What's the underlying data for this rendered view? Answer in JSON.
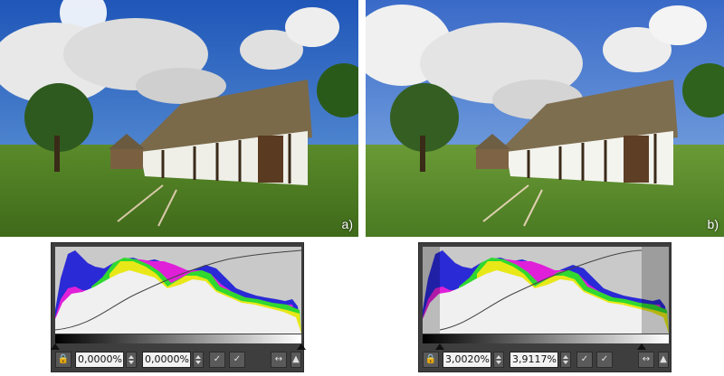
{
  "panels": [
    {
      "label": "a)",
      "low_value": "0,0000%",
      "high_value": "0,0000%",
      "clip_low": 0.0,
      "clip_high": 0.0,
      "black_marker": 0.0,
      "white_marker": 1.0
    },
    {
      "label": "b)",
      "low_value": "3,0020%",
      "high_value": "3,9117%",
      "clip_low": 0.07,
      "clip_high": 0.89,
      "black_marker": 0.07,
      "white_marker": 0.89
    }
  ],
  "icons": {
    "lock": "lock-icon",
    "black_picker": "eyedropper-black-icon",
    "white_picker": "eyedropper-white-icon",
    "fit": "fit-width-icon",
    "expand": "expand-icon"
  },
  "colors": {
    "panel_bg": "#3e3e3e",
    "hist_bg": "#c9c9c9",
    "blue": "#2a2ad6",
    "magenta": "#e020d8",
    "yellow": "#e8e818",
    "green": "#30d830",
    "red": "#e02020",
    "cyan": "#20d0e0"
  }
}
